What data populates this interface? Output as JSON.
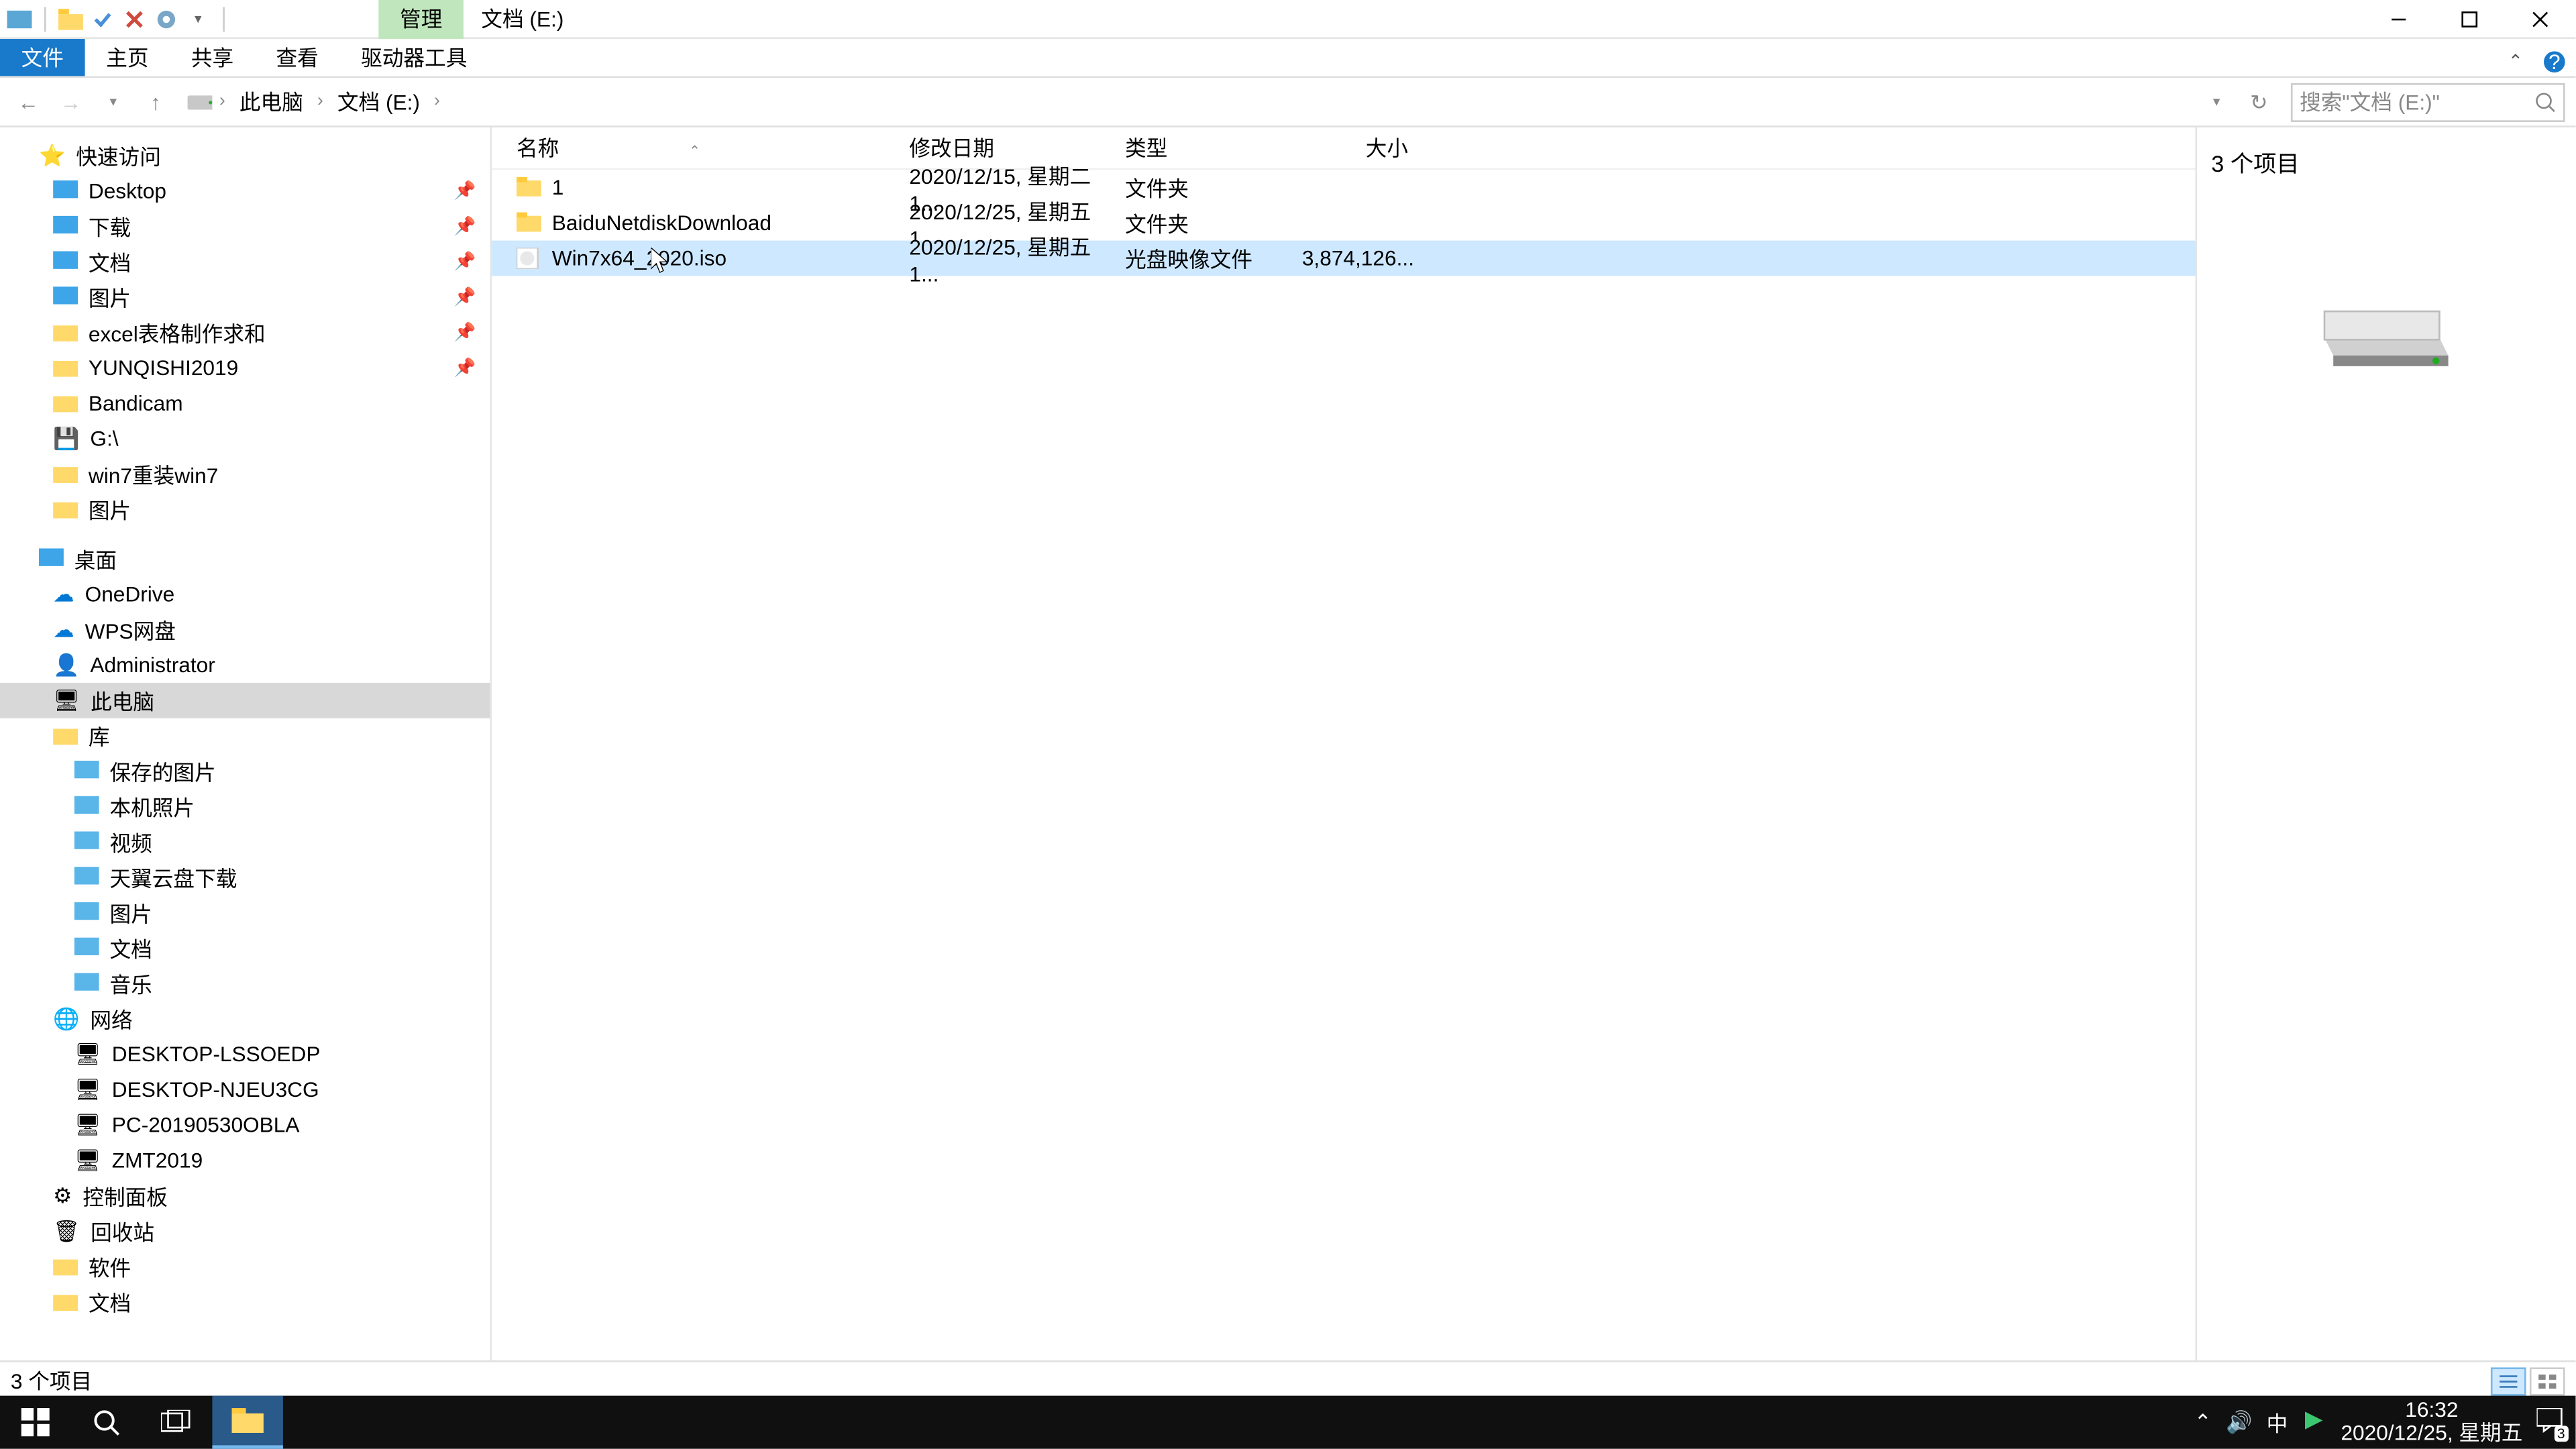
{
  "title_tab": "管理",
  "window_title": "文档 (E:)",
  "ribbon": {
    "file": "文件",
    "home": "主页",
    "share": "共享",
    "view": "查看",
    "drive": "驱动器工具"
  },
  "breadcrumb": {
    "b1": "此电脑",
    "b2": "文档 (E:)"
  },
  "search_placeholder": "搜索\"文档 (E:)\"",
  "sidebar": {
    "quick": "快速访问",
    "desktop": "Desktop",
    "downloads": "下载",
    "docs": "文档",
    "pics": "图片",
    "excel": "excel表格制作求和",
    "yunq": "YUNQISHI2019",
    "bandi": "Bandicam",
    "g": "G:\\",
    "win7r": "win7重装win7",
    "pics2": "图片",
    "desk": "桌面",
    "onedrive": "OneDrive",
    "wps": "WPS网盘",
    "admin": "Administrator",
    "thispc": "此电脑",
    "lib": "库",
    "saved": "保存的图片",
    "local": "本机照片",
    "video": "视频",
    "tianyi": "天翼云盘下载",
    "pics3": "图片",
    "docs3": "文档",
    "music": "音乐",
    "net": "网络",
    "d1": "DESKTOP-LSSOEDP",
    "d2": "DESKTOP-NJEU3CG",
    "d3": "PC-20190530OBLA",
    "d4": "ZMT2019",
    "cpanel": "控制面板",
    "recycle": "回收站",
    "soft": "软件",
    "docs4": "文档"
  },
  "cols": {
    "name": "名称",
    "date": "修改日期",
    "type": "类型",
    "size": "大小"
  },
  "files": [
    {
      "name": "1",
      "date": "2020/12/15, 星期二 1...",
      "type": "文件夹",
      "size": ""
    },
    {
      "name": "BaiduNetdiskDownload",
      "date": "2020/12/25, 星期五 1...",
      "type": "文件夹",
      "size": ""
    },
    {
      "name": "Win7x64_2020.iso",
      "date": "2020/12/25, 星期五 1...",
      "type": "光盘映像文件",
      "size": "3,874,126..."
    }
  ],
  "preview_count": "3 个项目",
  "status_text": "3 个项目",
  "tray": {
    "ime": "中",
    "time": "16:32",
    "date": "2020/12/25, 星期五",
    "badge": "3"
  }
}
